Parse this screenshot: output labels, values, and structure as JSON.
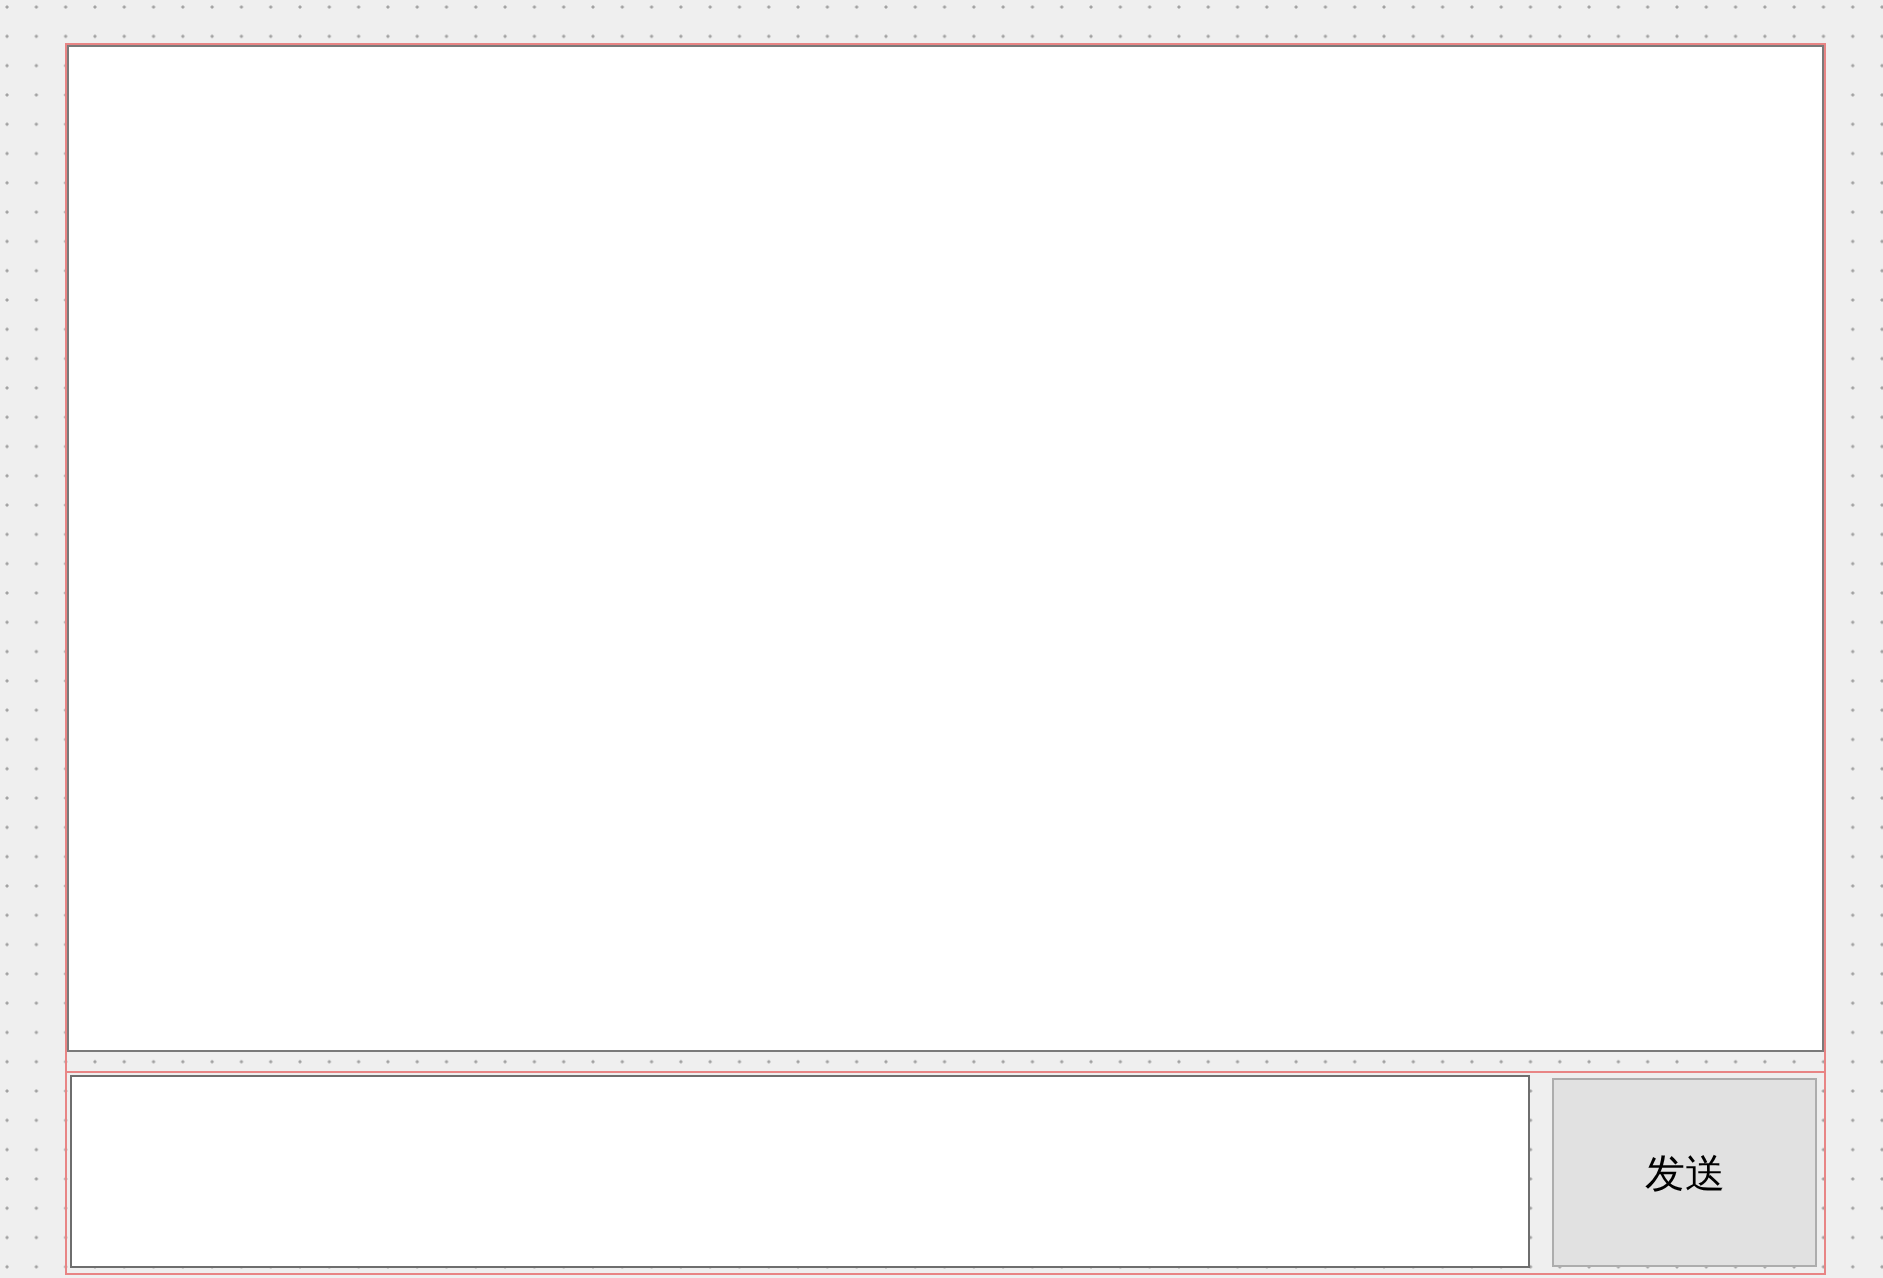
{
  "send_button": {
    "label": "发送"
  }
}
